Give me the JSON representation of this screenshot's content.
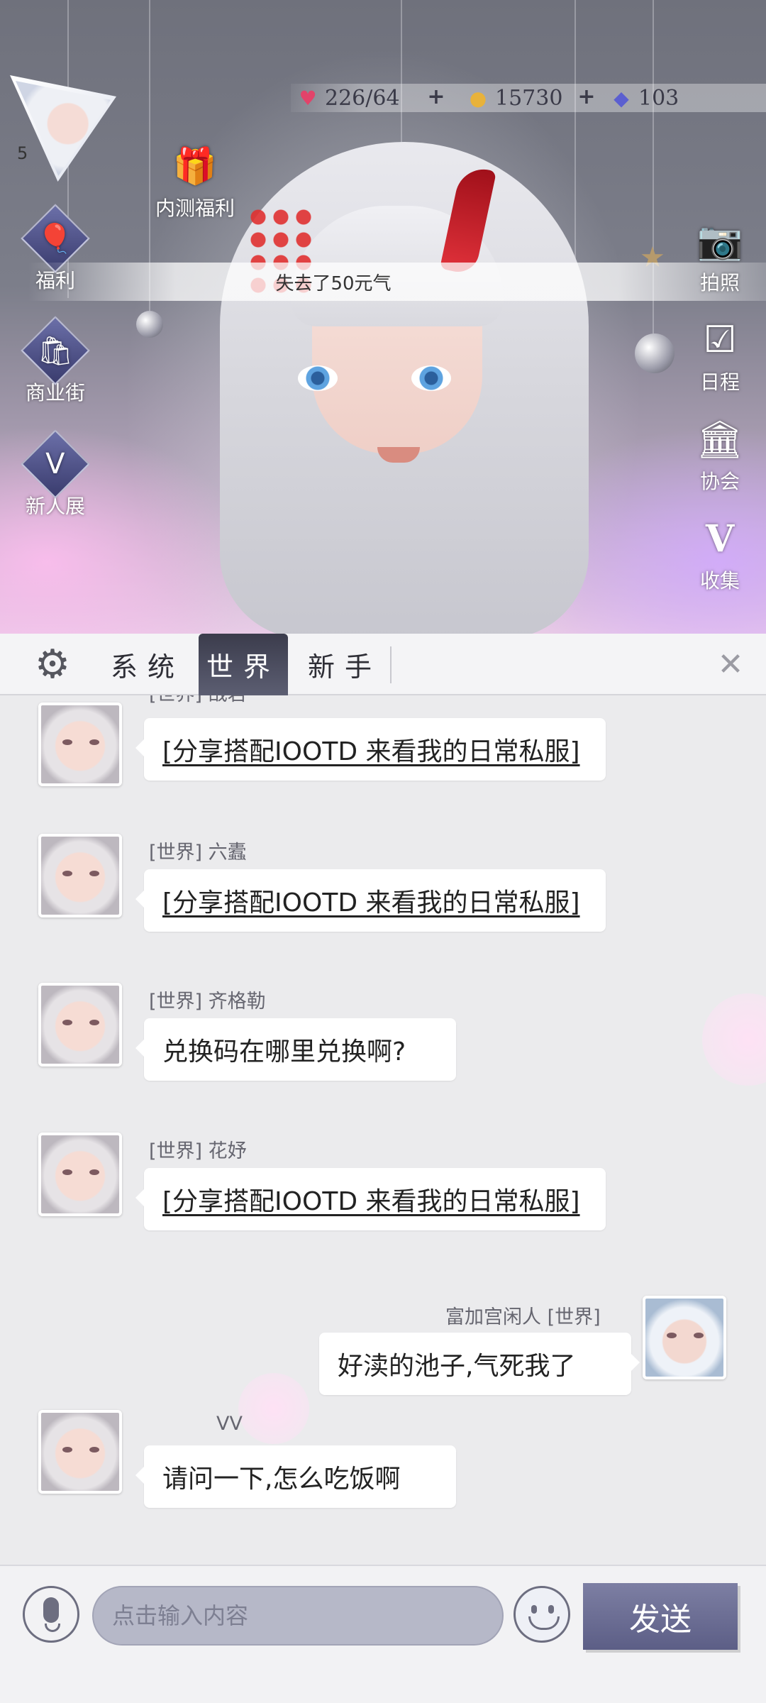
{
  "currency": {
    "stamina": "226/64",
    "coins": "15730",
    "diamonds": "103",
    "colors": {
      "stamina": "#e2436a",
      "coins": "#e8b23a",
      "diamonds": "#5b5fd0"
    }
  },
  "player": {
    "level": "5"
  },
  "left_menu": {
    "beta_welfare": "内测福利",
    "welfare": "福利",
    "shop_street": "商业街",
    "newbie_show": "新人展"
  },
  "right_menu": {
    "photo": "拍照",
    "schedule": "日程",
    "guild": "协会",
    "collection": "收集"
  },
  "notice": "失去了50元气",
  "chat": {
    "tabs": [
      {
        "label": "系统",
        "active": false
      },
      {
        "label": "世界",
        "active": true
      },
      {
        "label": "新手",
        "active": false
      }
    ],
    "messages": [
      {
        "name": "[世界] 战若",
        "text": "[分享搭配IOOTD 来看我的日常私服]",
        "link": true,
        "side": "left"
      },
      {
        "name": "[世界]  六蠹",
        "text": "[分享搭配IOOTD 来看我的日常私服]",
        "link": true,
        "side": "left"
      },
      {
        "name": "[世界]  齐格勒",
        "text": "兑换码在哪里兑换啊?",
        "link": false,
        "side": "left"
      },
      {
        "name": "[世界]  花妤",
        "text": "[分享搭配IOOTD 来看我的日常私服]",
        "link": true,
        "side": "left"
      },
      {
        "name": "富加宫闲人 [世界]",
        "text": "好渎的池子,气死我了",
        "link": false,
        "side": "right"
      },
      {
        "name": "VV",
        "text": "请问一下,怎么吃饭啊",
        "link": false,
        "side": "left"
      }
    ]
  },
  "input": {
    "placeholder": "点击输入内容",
    "send_label": "发送"
  }
}
